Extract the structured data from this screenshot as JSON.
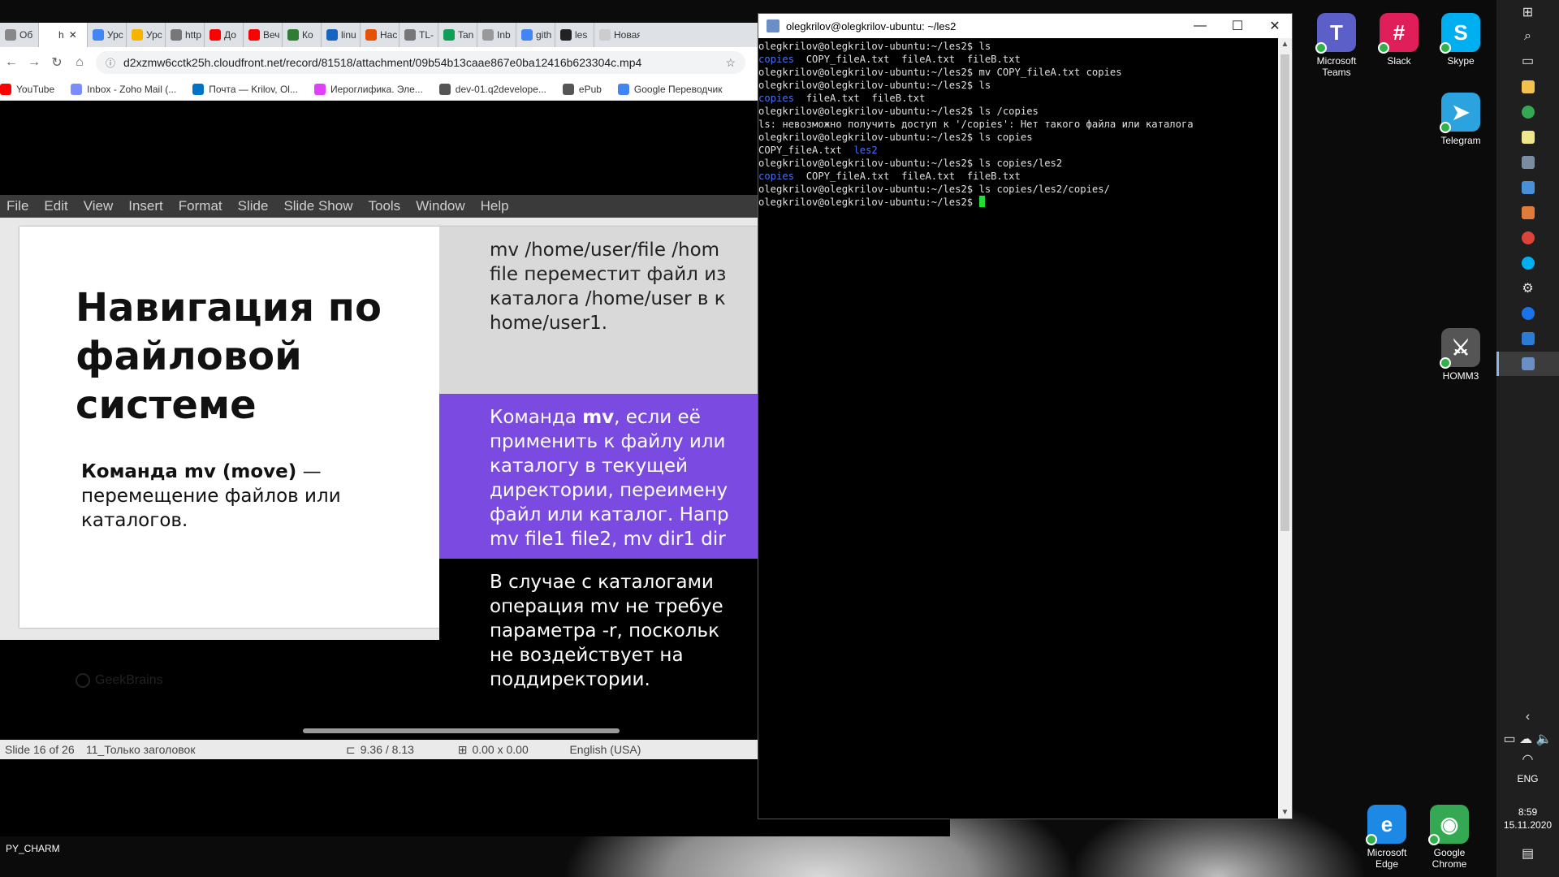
{
  "desktop": {
    "icons": [
      {
        "label": "Microsoft Teams",
        "color": "#5b5fc7",
        "glyph": "T"
      },
      {
        "label": "Slack",
        "color": "#e01e5a",
        "glyph": "#"
      },
      {
        "label": "Skype",
        "color": "#00aff0",
        "glyph": "S"
      },
      {
        "label": "Telegram",
        "color": "#2aa3de",
        "glyph": "➤"
      },
      {
        "label": "HOMM3",
        "color": "#555555",
        "glyph": "⚔"
      },
      {
        "label": "Microsoft Edge",
        "color": "#1e88e5",
        "glyph": "e"
      },
      {
        "label": "Google Chrome",
        "color": "#34a853",
        "glyph": "◉"
      }
    ],
    "pycharm_label": "PY_CHARM"
  },
  "browser": {
    "tabs": [
      {
        "label": "Об",
        "color": "#888888"
      },
      {
        "label": "h",
        "color": "#ffffff",
        "active": true
      },
      {
        "label": "Урс",
        "color": "#4285f4"
      },
      {
        "label": "Урс",
        "color": "#f4b400"
      },
      {
        "label": "http",
        "color": "#777777"
      },
      {
        "label": "До",
        "color": "#ff0000"
      },
      {
        "label": "Веч",
        "color": "#ff0000"
      },
      {
        "label": "Ко",
        "color": "#2e7d32"
      },
      {
        "label": "linu",
        "color": "#1565c0"
      },
      {
        "label": "Нас",
        "color": "#e65100"
      },
      {
        "label": "TL-",
        "color": "#777777"
      },
      {
        "label": "Tan",
        "color": "#0f9d58"
      },
      {
        "label": "Inb",
        "color": "#999999"
      },
      {
        "label": "gith",
        "color": "#4285f4"
      },
      {
        "label": "les",
        "color": "#222222"
      },
      {
        "label": "Новая",
        "color": "#cccccc"
      }
    ],
    "url": "d2xzmw6cctk25h.cloudfront.net/record/81518/attachment/09b54b13caae867e0ba12416b623304c.mp4",
    "bookmarks": [
      {
        "label": "YouTube",
        "color": "#ff0000"
      },
      {
        "label": "Inbox - Zoho Mail (...",
        "color": "#7a8cff"
      },
      {
        "label": "Почта — Krilov, Ol...",
        "color": "#0072c6"
      },
      {
        "label": "Иероглифика. Эле...",
        "color": "#e040fb"
      },
      {
        "label": "dev-01.q2develope...",
        "color": "#555555"
      },
      {
        "label": "ePub",
        "color": "#555555"
      },
      {
        "label": "Google Переводчик",
        "color": "#4285f4"
      }
    ]
  },
  "impress": {
    "menu": [
      "File",
      "Edit",
      "View",
      "Insert",
      "Format",
      "Slide",
      "Slide Show",
      "Tools",
      "Window",
      "Help"
    ],
    "slide": {
      "title": "Навигация по файловой системе",
      "sub_bold": "Команда mv (move)",
      "sub_rest": " — перемещение файлов или каталогов.",
      "logo": "GeekBrains",
      "panel1": [
        "mv /home/user/file /hom",
        "file переместит файл из",
        "каталога /home/user в к",
        "home/user1."
      ],
      "panel2_prefix": "Команда ",
      "panel2_bold": "mv",
      "panel2_rest": ", если её",
      "panel2": [
        "применить к файлу или",
        "каталогу в текущей",
        "директории, переимену",
        "файл или каталог. Напр",
        "mv file1 file2, mv dir1 dir"
      ],
      "panel3": [
        "В случае с каталогами",
        "операция mv не требуе",
        "параметра -r, поскольк",
        "не воздействует на",
        "поддиректории."
      ]
    },
    "status": {
      "slide": "Slide 16 of 26",
      "layout": "11_Только заголовок",
      "position": "9.36 / 8.13",
      "size": "0.00 x 0.00",
      "language": "English (USA)"
    }
  },
  "terminal": {
    "title": "olegkrilov@olegkrilov-ubuntu: ~/les2",
    "prompt": "olegkrilov@olegkrilov-ubuntu:~/les2$ ",
    "lines": [
      {
        "type": "cmd",
        "text": "ls"
      },
      {
        "type": "out",
        "dir": "copies",
        "text": "  COPY_fileA.txt  fileA.txt  fileB.txt"
      },
      {
        "type": "cmd",
        "text": "mv COPY_fileA.txt copies"
      },
      {
        "type": "cmd",
        "text": "ls"
      },
      {
        "type": "out",
        "dir": "copies",
        "text": "  fileA.txt  fileB.txt"
      },
      {
        "type": "cmd",
        "text": "ls /copies"
      },
      {
        "type": "plain",
        "text": "ls: невозможно получить доступ к '/copies': Нет такого файла или каталога"
      },
      {
        "type": "cmd",
        "text": "ls copies"
      },
      {
        "type": "outdir2",
        "pre": "COPY_fileA.txt  ",
        "dir": "les2"
      },
      {
        "type": "cmd",
        "text": "ls copies/les2"
      },
      {
        "type": "out",
        "dir": "copies",
        "text": "  COPY_fileA.txt  fileA.txt  fileB.txt"
      },
      {
        "type": "cmd",
        "text": "ls copies/les2/copies/"
      },
      {
        "type": "cmd",
        "text": "",
        "cursor": true
      }
    ]
  },
  "taskbar": {
    "lang": "ENG",
    "time": "8:59",
    "date": "15.11.2020"
  }
}
